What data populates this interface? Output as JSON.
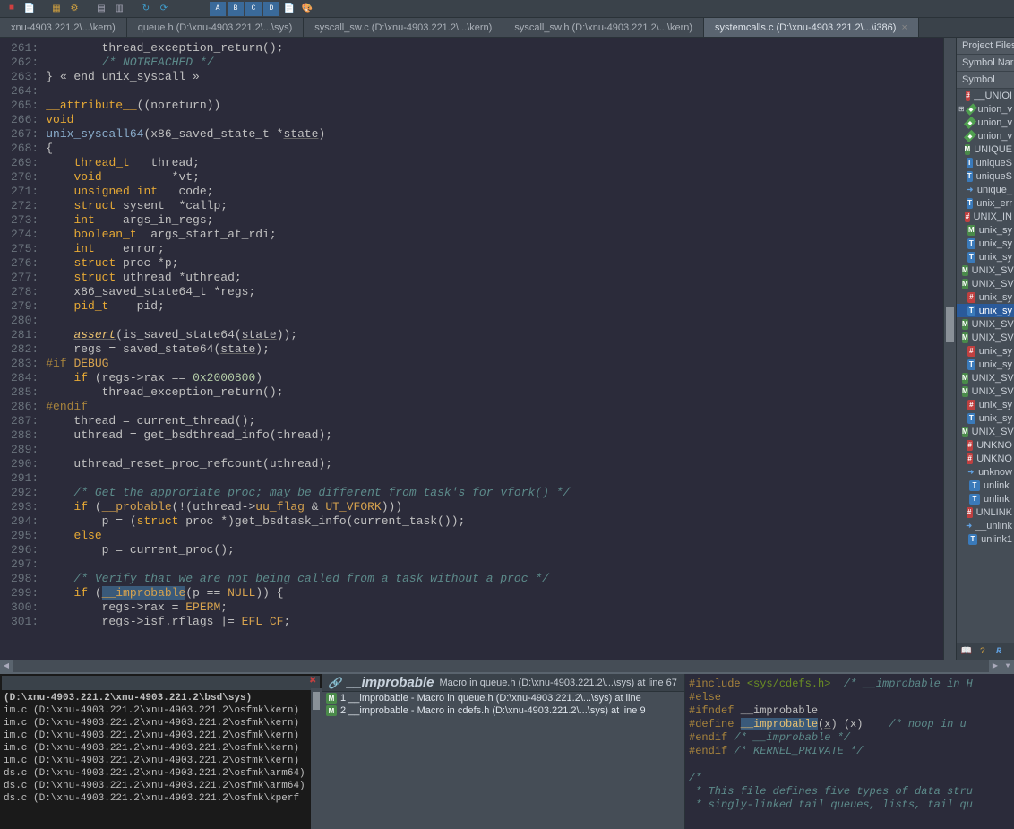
{
  "tabs": [
    {
      "label": "xnu-4903.221.2\\...\\kern)"
    },
    {
      "label": "queue.h (D:\\xnu-4903.221.2\\...\\sys)"
    },
    {
      "label": "syscall_sw.c (D:\\xnu-4903.221.2\\...\\kern)"
    },
    {
      "label": "syscall_sw.h (D:\\xnu-4903.221.2\\...\\kern)"
    },
    {
      "label": "systemcalls.c (D:\\xnu-4903.221.2\\...\\i386)"
    }
  ],
  "gutter_start": 261,
  "gutter_end": 302,
  "code_lines": [
    {
      "n": 261,
      "h": "        thread_exception_return();"
    },
    {
      "n": 262,
      "h": "        <span class='cmt'>/* NOTREACHED */</span>"
    },
    {
      "n": 263,
      "h": "} « end unix_syscall »"
    },
    {
      "n": 264,
      "h": ""
    },
    {
      "n": 265,
      "h": "<span class='kw'>__attribute__</span>((noreturn))"
    },
    {
      "n": 266,
      "h": "<span class='kw'>void</span>"
    },
    {
      "n": 267,
      "h": "<span class='funcdecl'>unix_syscall64</span>(x86_saved_state_t *<span class='param'>state</span>)"
    },
    {
      "n": 268,
      "h": "{"
    },
    {
      "n": 269,
      "h": "    <span class='type'>thread_t</span>   thread;"
    },
    {
      "n": 270,
      "h": "    <span class='kw'>void</span>          *vt;"
    },
    {
      "n": 271,
      "h": "    <span class='kw'>unsigned int</span>   code;"
    },
    {
      "n": 272,
      "h": "    <span class='kw'>struct</span> sysent  *callp;"
    },
    {
      "n": 273,
      "h": "    <span class='kw'>int</span>    args_in_regs;"
    },
    {
      "n": 274,
      "h": "    <span class='type'>boolean_t</span>  args_start_at_rdi;"
    },
    {
      "n": 275,
      "h": "    <span class='kw'>int</span>    error;"
    },
    {
      "n": 276,
      "h": "    <span class='kw'>struct</span> proc *p;"
    },
    {
      "n": 277,
      "h": "    <span class='kw'>struct</span> uthread *uthread;"
    },
    {
      "n": 278,
      "h": "    x86_saved_state64_t *regs;"
    },
    {
      "n": 279,
      "h": "    <span class='type'>pid_t</span>    pid;"
    },
    {
      "n": 280,
      "h": ""
    },
    {
      "n": 281,
      "h": "    <span class='funcname'><i>assert</i></span>(is_saved_state64(<span class='param'>state</span>));"
    },
    {
      "n": 282,
      "h": "    regs = saved_state64(<span class='param'>state</span>);"
    },
    {
      "n": 283,
      "h": "<span class='pp'>#if</span> <span class='macro'>DEBUG</span>"
    },
    {
      "n": 284,
      "h": "    <span class='kw'>if</span> (regs->rax == <span class='num'>0x2000800</span>)"
    },
    {
      "n": 285,
      "h": "        thread_exception_return();"
    },
    {
      "n": 286,
      "h": "<span class='pp'>#endif</span>"
    },
    {
      "n": 287,
      "h": "    thread = current_thread();"
    },
    {
      "n": 288,
      "h": "    uthread = get_bsdthread_info(thread);"
    },
    {
      "n": 289,
      "h": ""
    },
    {
      "n": 290,
      "h": "    uthread_reset_proc_refcount(uthread);"
    },
    {
      "n": 291,
      "h": ""
    },
    {
      "n": 292,
      "h": "    <span class='cmt'>/* Get the approriate proc; may be different from task's for vfork() */</span>"
    },
    {
      "n": 293,
      "h": "    <span class='kw'>if</span> (<span class='macro'>__probable</span>(!(uthread-><span class='macro'>uu_flag</span> &amp; <span class='macro'>UT_VFORK</span>)))"
    },
    {
      "n": 294,
      "h": "        p = (<span class='kw'>struct</span> proc *)get_bsdtask_info(current_task());"
    },
    {
      "n": 295,
      "h": "    <span class='kw'>else</span>"
    },
    {
      "n": 296,
      "h": "        p = current_proc();"
    },
    {
      "n": 297,
      "h": ""
    },
    {
      "n": 298,
      "h": "    <span class='cmt'>/* Verify that we are not being called from a task without a proc */</span>"
    },
    {
      "n": 299,
      "h": "    <span class='kw'>if</span> (<span class='hilite macro'>__improbable</span>(p == <span class='macro'>NULL</span>)) {"
    },
    {
      "n": 300,
      "h": "        regs->rax = <span class='macro'>EPERM</span>;"
    },
    {
      "n": 301,
      "h": "        regs->isf.rflags |= <span class='macro'>EFL_CF</span>;"
    }
  ],
  "symbol_panel": {
    "h1": "Project Files",
    "h2": "Symbol Nar",
    "h3": "Symbol",
    "items": [
      {
        "ic": "hash",
        "t": "__UNIOI"
      },
      {
        "ic": "diamond",
        "t": "union_v",
        "exp": true
      },
      {
        "ic": "diamond",
        "t": "union_v"
      },
      {
        "ic": "diamond",
        "t": "union_v"
      },
      {
        "ic": "m",
        "t": "UNIQUE"
      },
      {
        "ic": "t",
        "t": "uniqueS"
      },
      {
        "ic": "t",
        "t": "uniqueS"
      },
      {
        "ic": "arrow",
        "t": "unique_"
      },
      {
        "ic": "t",
        "t": "unix_err"
      },
      {
        "ic": "hash",
        "t": "UNIX_IN"
      },
      {
        "ic": "m",
        "t": "unix_sy"
      },
      {
        "ic": "t",
        "t": "unix_sy"
      },
      {
        "ic": "t",
        "t": "unix_sy"
      },
      {
        "ic": "m",
        "t": "UNIX_SV"
      },
      {
        "ic": "m",
        "t": "UNIX_SV"
      },
      {
        "ic": "hash",
        "t": "unix_sy"
      },
      {
        "ic": "t",
        "t": "unix_sy",
        "sel": true
      },
      {
        "ic": "m",
        "t": "UNIX_SV"
      },
      {
        "ic": "m",
        "t": "UNIX_SV"
      },
      {
        "ic": "hash",
        "t": "unix_sy"
      },
      {
        "ic": "t",
        "t": "unix_sy"
      },
      {
        "ic": "m",
        "t": "UNIX_SV"
      },
      {
        "ic": "m",
        "t": "UNIX_SV"
      },
      {
        "ic": "hash",
        "t": "unix_sy"
      },
      {
        "ic": "t",
        "t": "unix_sy"
      },
      {
        "ic": "m",
        "t": "UNIX_SV"
      },
      {
        "ic": "hash",
        "t": "UNKNO"
      },
      {
        "ic": "hash",
        "t": "UNKNO"
      },
      {
        "ic": "arrow",
        "t": "unknow"
      },
      {
        "ic": "t",
        "t": "unlink"
      },
      {
        "ic": "t",
        "t": "unlink"
      },
      {
        "ic": "hash",
        "t": "UNLINK"
      },
      {
        "ic": "arrow",
        "t": "__unlink"
      },
      {
        "ic": "t",
        "t": "unlink1"
      }
    ]
  },
  "output_pane": {
    "header": "(D:\\xnu-4903.221.2\\xnu-4903.221.2\\bsd\\sys)",
    "lines": [
      "im.c (D:\\xnu-4903.221.2\\xnu-4903.221.2\\osfmk\\kern)",
      "im.c (D:\\xnu-4903.221.2\\xnu-4903.221.2\\osfmk\\kern)",
      "im.c (D:\\xnu-4903.221.2\\xnu-4903.221.2\\osfmk\\kern)",
      "im.c (D:\\xnu-4903.221.2\\xnu-4903.221.2\\osfmk\\kern)",
      "im.c (D:\\xnu-4903.221.2\\xnu-4903.221.2\\osfmk\\kern)",
      "ds.c (D:\\xnu-4903.221.2\\xnu-4903.221.2\\osfmk\\arm64)",
      "ds.c (D:\\xnu-4903.221.2\\xnu-4903.221.2\\osfmk\\arm64)",
      "ds.c (D:\\xnu-4903.221.2\\xnu-4903.221.2\\osfmk\\kperf"
    ]
  },
  "refs_pane": {
    "title": "__improbable",
    "subtitle": "Macro in queue.h (D:\\xnu-4903.221.2\\...\\sys) at line 67",
    "items": [
      "1 __improbable - Macro in queue.h (D:\\xnu-4903.221.2\\...\\sys) at line",
      "2 __improbable - Macro in cdefs.h (D:\\xnu-4903.221.2\\...\\sys) at line 9"
    ]
  },
  "preview_lines": [
    "<span class='pp2'>#include</span> <span class='str2'>&lt;sys/cdefs.h&gt;</span>  <span class='cmt2'>/* __improbable in H</span>",
    "<span class='pp2'>#else</span>",
    "<span class='pp2'>#ifndef</span> __improbable",
    "<span class='pp2'>#define</span> <span class='hilite id2'>__improbable</span>(<span class='param'>x</span>) (x)    <span class='cmt2'>/* noop in u</span>",
    "<span class='pp2'>#endif</span> <span class='cmt2'>/* __improbable */</span>",
    "<span class='pp2'>#endif</span> <span class='cmt2'>/* KERNEL_PRIVATE */</span>",
    "",
    "<span class='cmt2'>/*</span>",
    "<span class='cmt2'> * This file defines five types of data stru</span>",
    "<span class='cmt2'> * singly-linked tail queues, lists, tail qu</span>"
  ]
}
